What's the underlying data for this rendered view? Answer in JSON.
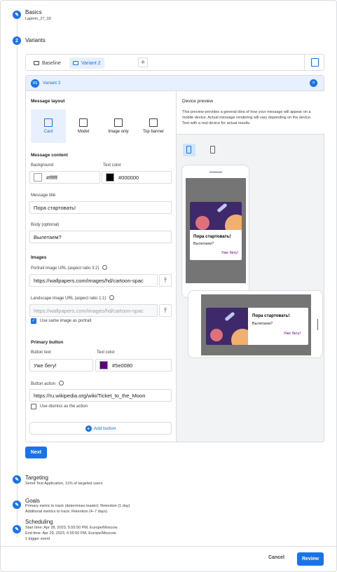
{
  "steps": {
    "basics": {
      "title": "Basics",
      "subtitle": "Laperin_27_03"
    },
    "variants": {
      "number": "2",
      "title": "Variants"
    },
    "targeting": {
      "title": "Targeting",
      "subtitle": "Sem4 Test Application, 11% of targeted users"
    },
    "goals": {
      "title": "Goals",
      "line1": "Primary metric to track (determines leader): Retention (1 day)",
      "line2": "Additional metrics to track: Retention (4–7 days)"
    },
    "scheduling": {
      "title": "Scheduling",
      "line1": "Start time: Apr 28, 2023, 5:55:50 PM, Europe/Moscow",
      "line2": "End time: Apr 29, 2023, 6:55:50 PM, Europe/Moscow",
      "line3": "1 trigger event"
    }
  },
  "tabs": [
    {
      "label": "Baseline",
      "active": false
    },
    {
      "label": "Variant 2",
      "active": true
    }
  ],
  "variant_panel": {
    "badge": "V1",
    "title": "Variant 2",
    "layout": {
      "label": "Message layout",
      "options": [
        {
          "label": "Card",
          "selected": true,
          "icon": "card-icon"
        },
        {
          "label": "Model",
          "selected": false,
          "icon": "modal-icon"
        },
        {
          "label": "Image only",
          "selected": false,
          "icon": "image-icon"
        },
        {
          "label": "Top banner",
          "selected": false,
          "icon": "banner-icon"
        }
      ]
    },
    "content": {
      "label": "Message content",
      "background_label": "Background",
      "background_value": "#ffffff",
      "text_color_label": "Text color",
      "text_color_value": "#000000",
      "title_label": "Message title",
      "title_value": "Пора стартовать!",
      "body_label": "Body (optional)",
      "body_value": "Вылетаем?"
    },
    "images": {
      "label": "Images",
      "portrait_label": "Portrait image URL (aspect ratio 3:2)",
      "portrait_value": "https://wallpapers.com/images/hd/cartoon-spac",
      "landscape_label": "Landscape image URL (aspect ratio 1:1)",
      "landscape_value": "https://wallpapers.com/images/hd/cartoon-spac",
      "same_label": "Use same image as portrait",
      "same_checked": true
    },
    "primary_button": {
      "label": "Primary button",
      "text_label": "Button text",
      "text_value": "Уже бегу!",
      "color_label": "Text color",
      "color_value": "#5e0080",
      "action_label": "Button action",
      "action_value": "https://ru.wikipedia.org/wiki/Ticket_to_the_Moon",
      "dismiss_label": "Use dismiss as the action",
      "dismiss_checked": false
    },
    "add_button_label": "Add button"
  },
  "preview": {
    "title": "Device preview",
    "description": "This preview provides a general idea of how your message will appear on a mobile device. Actual message rendering will vary depending on the device. Test with a real device for actual results.",
    "card_title": "Пора стартовать!",
    "card_body": "Вылетаем?",
    "card_button": "Уже бегу!"
  },
  "next_label": "Next",
  "footer": {
    "cancel_label": "Cancel",
    "review_label": "Review"
  },
  "colors": {
    "accent": "#1a73e8",
    "button_text": "#5e0080",
    "art_bg": "#3e2a6b"
  }
}
